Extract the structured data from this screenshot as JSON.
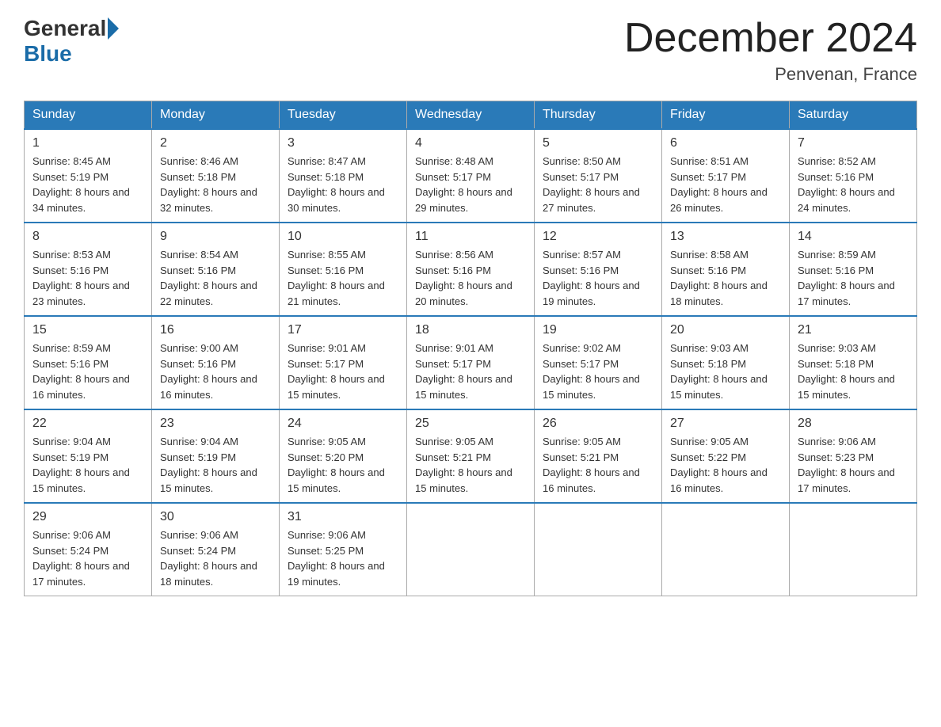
{
  "header": {
    "logo": {
      "general": "General",
      "blue": "Blue"
    },
    "title": "December 2024",
    "location": "Penvenan, France"
  },
  "weekdays": [
    "Sunday",
    "Monday",
    "Tuesday",
    "Wednesday",
    "Thursday",
    "Friday",
    "Saturday"
  ],
  "weeks": [
    [
      {
        "day": "1",
        "sunrise": "8:45 AM",
        "sunset": "5:19 PM",
        "daylight": "8 hours and 34 minutes."
      },
      {
        "day": "2",
        "sunrise": "8:46 AM",
        "sunset": "5:18 PM",
        "daylight": "8 hours and 32 minutes."
      },
      {
        "day": "3",
        "sunrise": "8:47 AM",
        "sunset": "5:18 PM",
        "daylight": "8 hours and 30 minutes."
      },
      {
        "day": "4",
        "sunrise": "8:48 AM",
        "sunset": "5:17 PM",
        "daylight": "8 hours and 29 minutes."
      },
      {
        "day": "5",
        "sunrise": "8:50 AM",
        "sunset": "5:17 PM",
        "daylight": "8 hours and 27 minutes."
      },
      {
        "day": "6",
        "sunrise": "8:51 AM",
        "sunset": "5:17 PM",
        "daylight": "8 hours and 26 minutes."
      },
      {
        "day": "7",
        "sunrise": "8:52 AM",
        "sunset": "5:16 PM",
        "daylight": "8 hours and 24 minutes."
      }
    ],
    [
      {
        "day": "8",
        "sunrise": "8:53 AM",
        "sunset": "5:16 PM",
        "daylight": "8 hours and 23 minutes."
      },
      {
        "day": "9",
        "sunrise": "8:54 AM",
        "sunset": "5:16 PM",
        "daylight": "8 hours and 22 minutes."
      },
      {
        "day": "10",
        "sunrise": "8:55 AM",
        "sunset": "5:16 PM",
        "daylight": "8 hours and 21 minutes."
      },
      {
        "day": "11",
        "sunrise": "8:56 AM",
        "sunset": "5:16 PM",
        "daylight": "8 hours and 20 minutes."
      },
      {
        "day": "12",
        "sunrise": "8:57 AM",
        "sunset": "5:16 PM",
        "daylight": "8 hours and 19 minutes."
      },
      {
        "day": "13",
        "sunrise": "8:58 AM",
        "sunset": "5:16 PM",
        "daylight": "8 hours and 18 minutes."
      },
      {
        "day": "14",
        "sunrise": "8:59 AM",
        "sunset": "5:16 PM",
        "daylight": "8 hours and 17 minutes."
      }
    ],
    [
      {
        "day": "15",
        "sunrise": "8:59 AM",
        "sunset": "5:16 PM",
        "daylight": "8 hours and 16 minutes."
      },
      {
        "day": "16",
        "sunrise": "9:00 AM",
        "sunset": "5:16 PM",
        "daylight": "8 hours and 16 minutes."
      },
      {
        "day": "17",
        "sunrise": "9:01 AM",
        "sunset": "5:17 PM",
        "daylight": "8 hours and 15 minutes."
      },
      {
        "day": "18",
        "sunrise": "9:01 AM",
        "sunset": "5:17 PM",
        "daylight": "8 hours and 15 minutes."
      },
      {
        "day": "19",
        "sunrise": "9:02 AM",
        "sunset": "5:17 PM",
        "daylight": "8 hours and 15 minutes."
      },
      {
        "day": "20",
        "sunrise": "9:03 AM",
        "sunset": "5:18 PM",
        "daylight": "8 hours and 15 minutes."
      },
      {
        "day": "21",
        "sunrise": "9:03 AM",
        "sunset": "5:18 PM",
        "daylight": "8 hours and 15 minutes."
      }
    ],
    [
      {
        "day": "22",
        "sunrise": "9:04 AM",
        "sunset": "5:19 PM",
        "daylight": "8 hours and 15 minutes."
      },
      {
        "day": "23",
        "sunrise": "9:04 AM",
        "sunset": "5:19 PM",
        "daylight": "8 hours and 15 minutes."
      },
      {
        "day": "24",
        "sunrise": "9:05 AM",
        "sunset": "5:20 PM",
        "daylight": "8 hours and 15 minutes."
      },
      {
        "day": "25",
        "sunrise": "9:05 AM",
        "sunset": "5:21 PM",
        "daylight": "8 hours and 15 minutes."
      },
      {
        "day": "26",
        "sunrise": "9:05 AM",
        "sunset": "5:21 PM",
        "daylight": "8 hours and 16 minutes."
      },
      {
        "day": "27",
        "sunrise": "9:05 AM",
        "sunset": "5:22 PM",
        "daylight": "8 hours and 16 minutes."
      },
      {
        "day": "28",
        "sunrise": "9:06 AM",
        "sunset": "5:23 PM",
        "daylight": "8 hours and 17 minutes."
      }
    ],
    [
      {
        "day": "29",
        "sunrise": "9:06 AM",
        "sunset": "5:24 PM",
        "daylight": "8 hours and 17 minutes."
      },
      {
        "day": "30",
        "sunrise": "9:06 AM",
        "sunset": "5:24 PM",
        "daylight": "8 hours and 18 minutes."
      },
      {
        "day": "31",
        "sunrise": "9:06 AM",
        "sunset": "5:25 PM",
        "daylight": "8 hours and 19 minutes."
      },
      null,
      null,
      null,
      null
    ]
  ]
}
